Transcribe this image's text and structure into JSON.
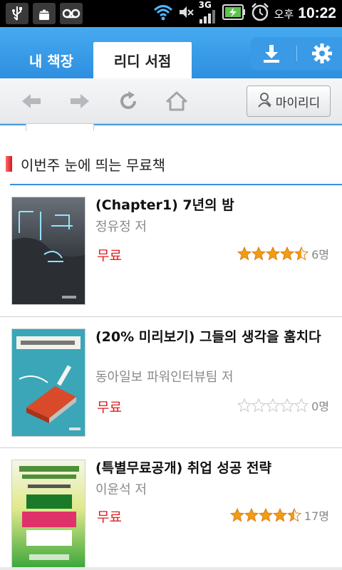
{
  "status_bar": {
    "time": "10:22",
    "ampm": "오후",
    "network": "3G",
    "icons": [
      "usb-icon",
      "android-debug-icon",
      "voicemail-icon",
      "wifi-icon",
      "mute-icon",
      "signal-icon",
      "battery-icon",
      "alarm-icon"
    ]
  },
  "tabs": [
    {
      "label": "내 책장",
      "active": false
    },
    {
      "label": "리디 서점",
      "active": true
    }
  ],
  "header_actions": [
    "download-icon",
    "settings-icon"
  ],
  "toolbar": {
    "icons": [
      "back-arrow-icon",
      "forward-arrow-icon",
      "refresh-icon",
      "home-icon"
    ],
    "myridi_label": "마이리디"
  },
  "section": {
    "title": "이번주 눈에 띄는 무료책"
  },
  "books": [
    {
      "title": "(Chapter1) 7년의 밤",
      "author": "정유정 저",
      "price": "무료",
      "rating": 4.5,
      "count": "6명"
    },
    {
      "title": "(20% 미리보기) 그들의 생각을 훔치다",
      "author": "동아일보 파워인터뷰팀 저",
      "price": "무료",
      "rating": 0,
      "count": "0명"
    },
    {
      "title": "(특별무료공개) 취업 성공 전략",
      "author": "이윤석 저",
      "price": "무료",
      "rating": 4.5,
      "count": "17명"
    }
  ],
  "colors": {
    "accent": "#2e8fe0",
    "price": "#e02020",
    "star": "#f39c12"
  }
}
